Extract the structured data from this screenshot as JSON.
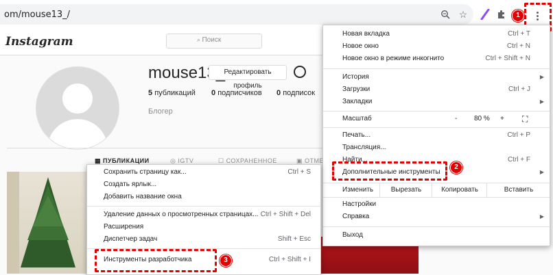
{
  "browser": {
    "url": "om/mouse13_/",
    "icons": [
      "zoom-icon",
      "star-icon",
      "feather-icon",
      "extensions-icon",
      "kebab-menu-icon"
    ]
  },
  "instagram": {
    "logo": "Instagram",
    "search_placeholder": "Поиск",
    "username": "mouse13_",
    "edit_profile": "Редактировать профиль",
    "stats": [
      {
        "count": "5",
        "label": "публикаций"
      },
      {
        "count": "0",
        "label": "подписчиков"
      },
      {
        "count": "0",
        "label": "подписок"
      }
    ],
    "bio": "Блогер",
    "tabs": [
      "ПУБЛИКАЦИИ",
      "IGTV",
      "СОХРАНЕННОЕ",
      "ОТМЕТ"
    ]
  },
  "main_menu": {
    "items": [
      {
        "label": "Новая вкладка",
        "shortcut": "Ctrl + T"
      },
      {
        "label": "Новое окно",
        "shortcut": "Ctrl + N"
      },
      {
        "label": "Новое окно в режиме инкогнито",
        "shortcut": "Ctrl + Shift + N"
      },
      {
        "label": "История",
        "shortcut": ""
      },
      {
        "label": "Загрузки",
        "shortcut": "Ctrl + J"
      },
      {
        "label": "Закладки",
        "shortcut": ""
      },
      {
        "label": "Печать...",
        "shortcut": "Ctrl + P"
      },
      {
        "label": "Трансляция...",
        "shortcut": ""
      },
      {
        "label": "Найти...",
        "shortcut": "Ctrl + F"
      },
      {
        "label": "Дополнительные инструменты",
        "shortcut": ""
      },
      {
        "label": "Настройки",
        "shortcut": ""
      },
      {
        "label": "Справка",
        "shortcut": ""
      },
      {
        "label": "Выход",
        "shortcut": ""
      }
    ],
    "zoom": {
      "label": "Масштаб",
      "minus": "-",
      "value": "80 %",
      "plus": "+"
    },
    "edit": {
      "label": "Изменить",
      "cut": "Вырезать",
      "copy": "Копировать",
      "paste": "Вставить"
    }
  },
  "sub_menu": {
    "items": [
      {
        "label": "Сохранить страницу как...",
        "shortcut": "Ctrl + S"
      },
      {
        "label": "Создать ярлык...",
        "shortcut": ""
      },
      {
        "label": "Добавить название окна",
        "shortcut": ""
      },
      {
        "label": "Удаление данных о просмотренных страницах...",
        "shortcut": "Ctrl + Shift + Del"
      },
      {
        "label": "Расширения",
        "shortcut": ""
      },
      {
        "label": "Диспетчер задач",
        "shortcut": "Shift + Esc"
      },
      {
        "label": "Инструменты разработчика",
        "shortcut": "Ctrl + Shift + I"
      }
    ]
  },
  "badges": [
    "1",
    "2",
    "3"
  ],
  "colors": {
    "highlight": "#e50000",
    "menu_bg": "#ffffff",
    "page_bg": "#fafafa"
  }
}
